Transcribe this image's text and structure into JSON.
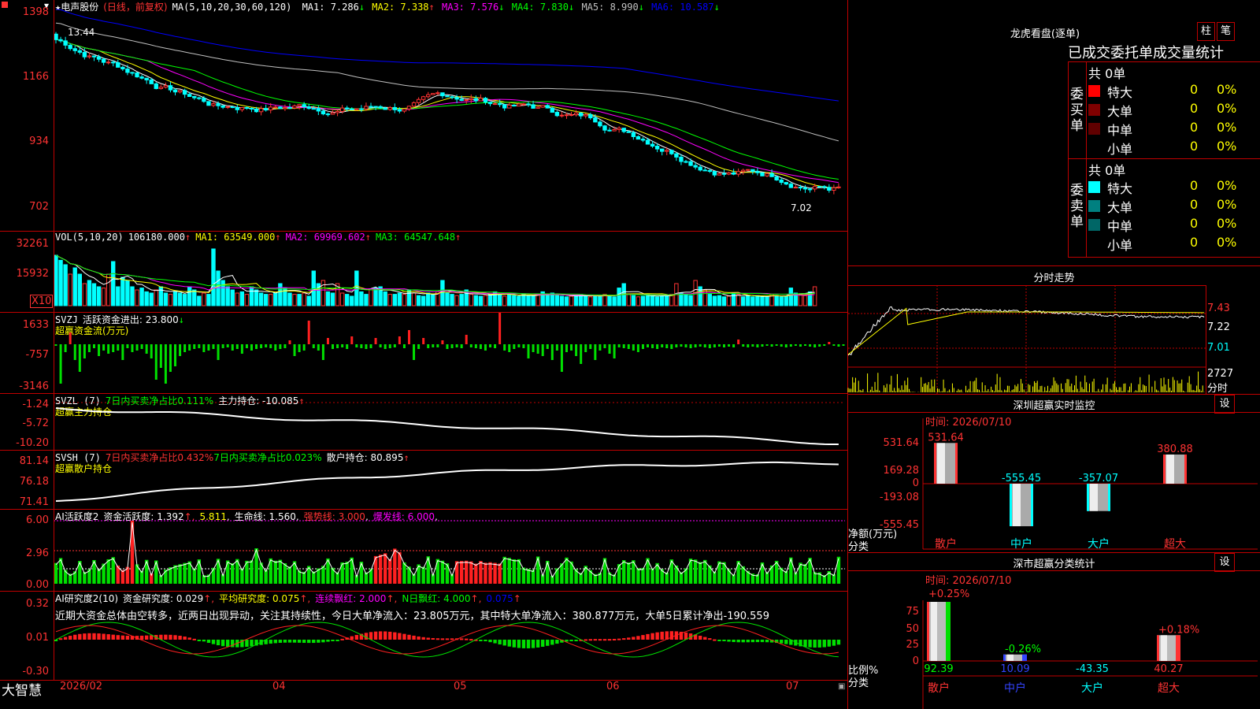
{
  "price_panel": {
    "stock_name": "电声股份",
    "period": "(日线，前复权)",
    "ma_params": "MA(5,10,20,30,60,120)",
    "ma": [
      {
        "label": "MA1:",
        "value": "7.286",
        "arrow": "↓",
        "color": "#ffffff"
      },
      {
        "label": "MA2:",
        "value": "7.338",
        "arrow": "↑",
        "color": "#ffff00"
      },
      {
        "label": "MA3:",
        "value": "7.576",
        "arrow": "↓",
        "color": "#ff00ff"
      },
      {
        "label": "MA4:",
        "value": "7.830",
        "arrow": "↓",
        "color": "#00ff00"
      },
      {
        "label": "MA5:",
        "value": "8.990",
        "arrow": "↓",
        "color": "#c0c0c0"
      },
      {
        "label": "MA6:",
        "value": "10.587",
        "arrow": "↓",
        "color": "#0000ff"
      }
    ],
    "y_ticks": [
      "1398",
      "1166",
      "934",
      "702"
    ],
    "high_mark": "13.44",
    "last_price_mark": "7.02"
  },
  "vol_panel": {
    "title": "VOL(5,10,20)",
    "value": "106180.000",
    "ma1": "MA1: 63549.000",
    "ma2": "MA2: 69969.602",
    "ma3": "MA3: 64547.648",
    "y_ticks": [
      "32261",
      "15932"
    ],
    "unit": "X10",
    "values": [
      80,
      72,
      65,
      50,
      60,
      50,
      35,
      40,
      35,
      30,
      28,
      50,
      70,
      30,
      45,
      40,
      30,
      25,
      28,
      22,
      20,
      25,
      30,
      20,
      18,
      22,
      20,
      18,
      30,
      25,
      15,
      20,
      18,
      90,
      55,
      40,
      30,
      25,
      20,
      22,
      18,
      30,
      25,
      20,
      18,
      18,
      20,
      35,
      28,
      20,
      18,
      18,
      20,
      15,
      55,
      35,
      40,
      22,
      20,
      35,
      20,
      18,
      15,
      55,
      22,
      18,
      25,
      28,
      30,
      22,
      18,
      18,
      20,
      18,
      25,
      20,
      16,
      15,
      20,
      18,
      22,
      40,
      20,
      18,
      16,
      18,
      25,
      18,
      16,
      15,
      16,
      18,
      22,
      18,
      15,
      18,
      16,
      15,
      18,
      16,
      15,
      18,
      22,
      18,
      20,
      16,
      15,
      14,
      15,
      16,
      18,
      15,
      14,
      15,
      16,
      18,
      15,
      14,
      28,
      35,
      18,
      16,
      14,
      15,
      18,
      16,
      14,
      15,
      16,
      18,
      35,
      20,
      18,
      16,
      40,
      30,
      25,
      18,
      15,
      16,
      14,
      15,
      20,
      18,
      14,
      15,
      14,
      16,
      14,
      15,
      18,
      16,
      14,
      15,
      28,
      20,
      18,
      16,
      22,
      30
    ],
    "up_days": [
      6,
      11,
      21,
      31,
      40,
      50,
      56,
      60,
      70,
      75,
      84,
      90,
      101,
      112,
      120,
      130,
      134,
      141,
      150,
      156,
      159
    ]
  },
  "svzj_panel": {
    "title": "SVZJ",
    "label": "活跃资金进出: 23.800",
    "arrow": "↓",
    "sublabel": "超赢资金流(万元)",
    "y_ticks": [
      "1633",
      "-757",
      "-3146"
    ],
    "values": [
      -2,
      -50,
      -10,
      15,
      -20,
      -35,
      -18,
      -10,
      -5,
      -15,
      -8,
      -12,
      -10,
      -8,
      -20,
      -5,
      -10,
      -8,
      -6,
      -12,
      -18,
      -45,
      -30,
      -50,
      -35,
      -28,
      -15,
      -10,
      -8,
      -6,
      -5,
      -10,
      -8,
      -6,
      -20,
      -5,
      -4,
      -8,
      -6,
      -12,
      -5,
      -8,
      -6,
      -5,
      -4,
      -5,
      -8,
      -6,
      -5,
      5,
      -15,
      -10,
      -8,
      30,
      -5,
      -8,
      -20,
      8,
      -6,
      -5,
      -4,
      -6,
      10,
      -4,
      -5,
      -6,
      -5,
      8,
      -4,
      -6,
      -5,
      -4,
      10,
      -5,
      18,
      -20,
      -6,
      8,
      -5,
      -4,
      -4,
      5,
      -6,
      -5,
      -4,
      -5,
      12,
      -4,
      -5,
      -6,
      -8,
      -4,
      -5,
      40,
      -8,
      -10,
      -6,
      -4,
      -5,
      -18,
      -10,
      -12,
      -15,
      -6,
      -20,
      -8,
      -35,
      -10,
      -8,
      -15,
      -25,
      -10,
      -6,
      -20,
      -8,
      -5,
      -12,
      -18,
      -4,
      -5,
      -6,
      -8,
      -10,
      -6,
      -4,
      -5,
      -6,
      -4,
      -5,
      -6,
      -4,
      -3,
      -4,
      -5,
      -4,
      -3,
      -4,
      -5,
      -4,
      -3,
      -4,
      -3,
      -4,
      6,
      -3,
      -4,
      -3,
      -4,
      -3,
      -2,
      -3,
      -2,
      -3,
      -4,
      -3,
      -2,
      -3,
      -2,
      -3,
      -4,
      -3,
      -2,
      3,
      -2,
      -3,
      -2
    ]
  },
  "svzl_panel": {
    "title": "SVZL (7)",
    "label1": "7日内买卖净占比0.111%",
    "label2": "主力持仓: -10.085",
    "arrow": "↑",
    "sublabel": "超赢主力持仓",
    "y_ticks": [
      "-1.24",
      "-5.72",
      "-10.20"
    ]
  },
  "svsh_panel": {
    "title": "SVSH (7)",
    "label1": "7日内买卖净占比0.432%",
    "label2": "7日内买卖净占比0.023%",
    "label3": "散户持仓: 80.895",
    "arrow": "↑",
    "sublabel": "超赢散户持仓",
    "y_ticks": [
      "81.14",
      "76.18",
      "71.41"
    ]
  },
  "ai_active_panel": {
    "title": "AI活跃度2",
    "label1": "资金活跃度: 1.392",
    "label2": "5.811",
    "label3": "生命线: 1.560",
    "label4": "强势线: 3.000",
    "label5": "爆发线: 6.000",
    "y_ticks": [
      "6.00",
      "2.96",
      "0.00"
    ]
  },
  "ai_research_panel": {
    "title": "AI研究度2(10)",
    "label1": "资金研究度: 0.029",
    "label2": "平均研究度: 0.075",
    "label3": "连续飘红: 2.000",
    "label4": "N日飘红: 4.000",
    "label5": "0.075",
    "comment": "近期大资金总体由空转多，近两日出现异动，关注其持续性，今日大单净流入：23.805万元，其中特大单净流入：380.877万元，大单5日累计净出-190.559",
    "y_ticks": [
      "0.32",
      "0.01",
      "-0.30"
    ]
  },
  "x_axis": {
    "brand": "大智慧",
    "labels": [
      "2026/02",
      "04",
      "05",
      "06",
      "07"
    ]
  },
  "dragon_tiger": {
    "title": "龙虎看盘(逐单)",
    "btn1": "柱",
    "btn2": "笔",
    "subtitle": "已成交委托单成交量统计",
    "buy_label": "委买单",
    "sell_label": "委卖单",
    "buy_total": "共 0单",
    "sell_total": "共 0单",
    "buy_rows": [
      {
        "name": "特大",
        "count": "0",
        "pct": "0%",
        "color": "#ff0000"
      },
      {
        "name": "大单",
        "count": "0",
        "pct": "0%",
        "color": "#800000"
      },
      {
        "name": "中单",
        "count": "0",
        "pct": "0%",
        "color": "#600000"
      },
      {
        "name": "小单",
        "count": "0",
        "pct": "0%",
        "color": "#000000"
      }
    ],
    "sell_rows": [
      {
        "name": "特大",
        "count": "0",
        "pct": "0%",
        "color": "#00ffff"
      },
      {
        "name": "大单",
        "count": "0",
        "pct": "0%",
        "color": "#008080"
      },
      {
        "name": "中单",
        "count": "0",
        "pct": "0%",
        "color": "#006666"
      },
      {
        "name": "小单",
        "count": "0",
        "pct": "0%",
        "color": "#000000"
      }
    ]
  },
  "intraday": {
    "title": "分时走势",
    "prices": [
      "7.43",
      "7.22",
      "7.01"
    ],
    "vol_label": "2727",
    "unit_label": "分时"
  },
  "sz_monitor": {
    "title": "深圳超赢实时监控",
    "btn": "设",
    "time": "时间: 2026/07/10",
    "y_ticks": [
      "531.64",
      "169.28",
      "0",
      "-193.08",
      "-555.45"
    ],
    "side_label1": "净额(万元)",
    "side_label2": "分类",
    "bars": [
      {
        "cat": "散户",
        "value": 531.64,
        "label": "531.64"
      },
      {
        "cat": "中户",
        "value": -555.45,
        "label": "-555.45"
      },
      {
        "cat": "大户",
        "value": -357.07,
        "label": "-357.07"
      },
      {
        "cat": "超大",
        "value": 380.88,
        "label": "380.88"
      }
    ]
  },
  "sz_class": {
    "title": "深市超赢分类统计",
    "btn": "设",
    "time": "时间: 2026/07/10",
    "y_ticks": [
      "75",
      "50",
      "25",
      "0"
    ],
    "side_label1": "比例%",
    "side_label2": "分类",
    "bars": [
      {
        "cat": "散户",
        "value": 92.39,
        "label": "92.39",
        "pct": "+0.25%"
      },
      {
        "cat": "中户",
        "value": 10.09,
        "label": "10.09",
        "pct": "-0.26%"
      },
      {
        "cat": "大户",
        "value": -43.35,
        "label": "-43.35",
        "pct": ""
      },
      {
        "cat": "超大",
        "value": 40.27,
        "label": "40.27",
        "pct": "+0.18%"
      }
    ]
  }
}
